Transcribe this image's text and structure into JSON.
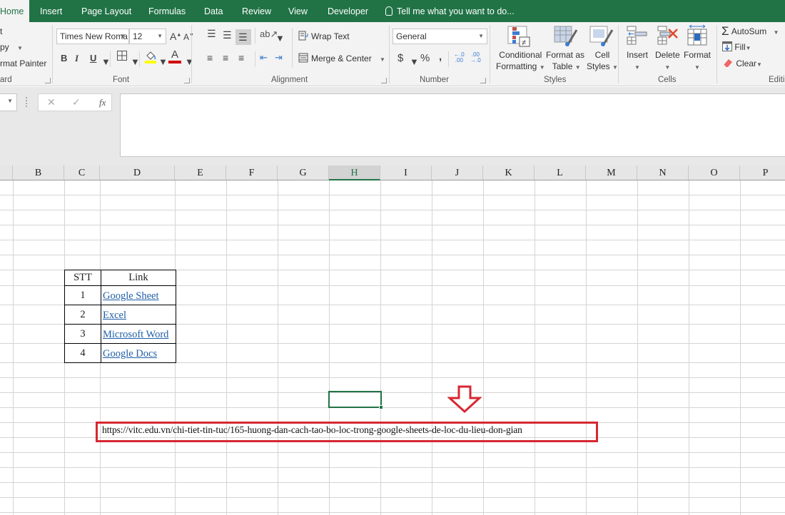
{
  "tabs": [
    {
      "label": "Home",
      "active": true
    },
    {
      "label": "Insert"
    },
    {
      "label": "Page Layout"
    },
    {
      "label": "Formulas"
    },
    {
      "label": "Data"
    },
    {
      "label": "Review"
    },
    {
      "label": "View"
    },
    {
      "label": "Developer"
    }
  ],
  "tell_me": "Tell me what you want to do...",
  "clipboard": {
    "cut": "t",
    "copy": "py",
    "format_painter": "rmat Painter",
    "label": "ard"
  },
  "font": {
    "name": "Times New Roma",
    "size": "12",
    "grow": "A",
    "shrink": "A",
    "bold": "B",
    "italic": "I",
    "underline": "U",
    "color_letter": "A",
    "fill_color": "#ffff00",
    "font_color": "#d00000",
    "label": "Font"
  },
  "alignment": {
    "wrap_text": "Wrap Text",
    "merge_center": "Merge & Center",
    "label": "Alignment"
  },
  "number": {
    "format": "General",
    "currency": "$",
    "percent": "%",
    "comma": ",",
    "increase_decimal": "←.0 .00",
    "decrease_decimal": ".00 →.0",
    "label": "Number"
  },
  "styles": {
    "conditional_formatting_1": "Conditional",
    "conditional_formatting_2": "Formatting",
    "format_as_table_1": "Format as",
    "format_as_table_2": "Table",
    "cell_styles_1": "Cell",
    "cell_styles_2": "Styles",
    "label": "Styles"
  },
  "cells": {
    "insert": "Insert",
    "delete": "Delete",
    "format": "Format",
    "label": "Cells"
  },
  "editing": {
    "autosum": "AutoSum",
    "fill": "Fill",
    "clear": "Clear",
    "label": "Editi"
  },
  "formula_bar": {
    "cancel": "✕",
    "enter": "✓",
    "fx": "fx",
    "value": ""
  },
  "columns": [
    "B",
    "C",
    "D",
    "E",
    "F",
    "G",
    "H",
    "I",
    "J",
    "K",
    "L",
    "M",
    "N",
    "O",
    "P"
  ],
  "selected_column": "H",
  "table": {
    "headers": [
      "STT",
      "Link"
    ],
    "rows": [
      {
        "stt": "1",
        "link": "Google Sheet"
      },
      {
        "stt": "2",
        "link": "Excel"
      },
      {
        "stt": "3",
        "link": "Microsoft Word"
      },
      {
        "stt": "4",
        "link": "Google Docs"
      }
    ]
  },
  "url_cell": "https://vitc.edu.vn/chi-tiet-tin-tuc/165-huong-dan-cach-tao-bo-loc-trong-google-sheets-de-loc-du-lieu-don-gian",
  "colors": {
    "brand": "#217346",
    "annotation_red": "#d62832",
    "link_blue": "#1f5fa8"
  }
}
